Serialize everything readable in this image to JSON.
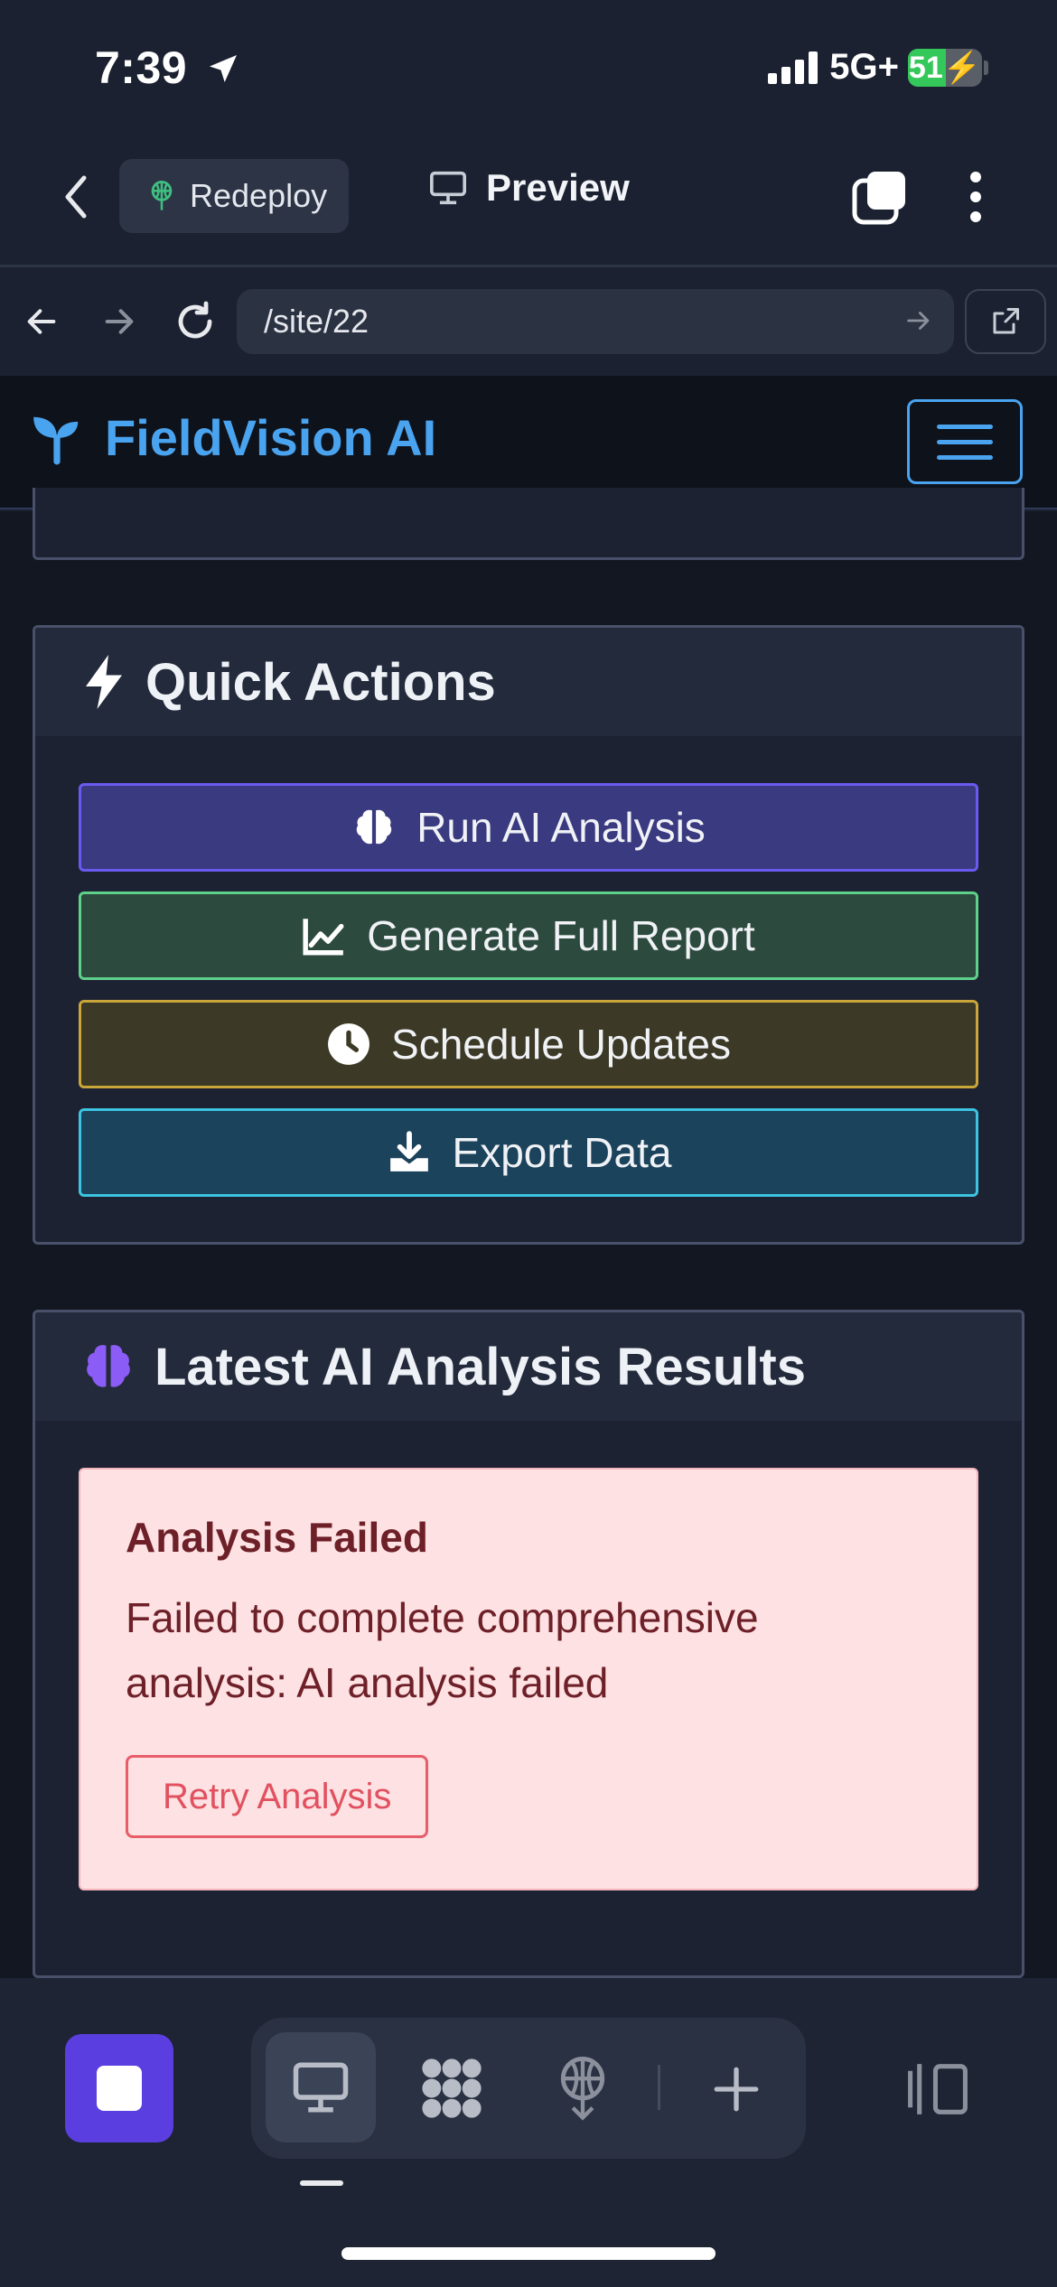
{
  "status_bar": {
    "time": "7:39",
    "network": "5G+",
    "battery_level": "51",
    "battery_percent": 51
  },
  "browser": {
    "redeploy_label": "Redeploy",
    "preview_label": "Preview",
    "url": "/site/22"
  },
  "site": {
    "brand": "FieldVision AI"
  },
  "quick_actions": {
    "title": "Quick Actions",
    "buttons": [
      {
        "label": "Run AI Analysis",
        "icon": "brain-icon"
      },
      {
        "label": "Generate Full Report",
        "icon": "chart-line-icon"
      },
      {
        "label": "Schedule Updates",
        "icon": "clock-icon"
      },
      {
        "label": "Export Data",
        "icon": "download-icon"
      }
    ]
  },
  "analysis": {
    "title": "Latest AI Analysis Results",
    "error_title": "Analysis Failed",
    "error_message": "Failed to complete comprehensive analysis: AI analysis failed",
    "retry_label": "Retry Analysis"
  },
  "colors": {
    "brand": "#4aa3ef",
    "run_ai": "#3a3a80",
    "report": "#2c4a3e",
    "schedule": "#3c3a26",
    "export": "#1c435c",
    "error_bg": "#fde1e3"
  }
}
